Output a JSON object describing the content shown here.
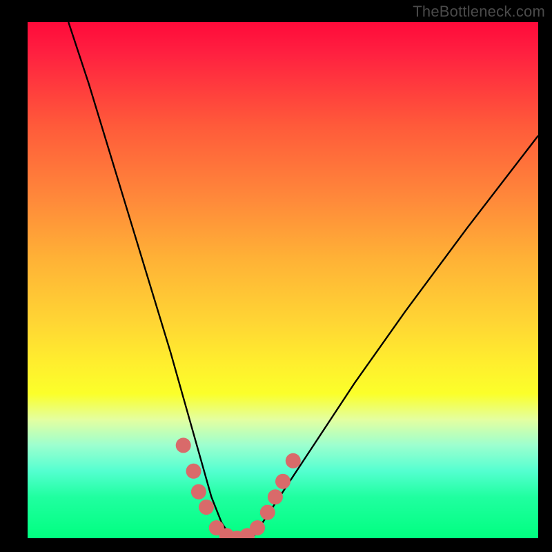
{
  "watermark": "TheBottleneck.com",
  "chart_data": {
    "type": "line",
    "title": "",
    "xlabel": "",
    "ylabel": "",
    "xlim": [
      0,
      100
    ],
    "ylim": [
      0,
      100
    ],
    "series": [
      {
        "name": "bottleneck-curve",
        "x": [
          8,
          12,
          16,
          20,
          24,
          28,
          30,
          32,
          34,
          36,
          38,
          40,
          42,
          44,
          46,
          50,
          56,
          64,
          74,
          86,
          100
        ],
        "values": [
          100,
          88,
          75,
          62,
          49,
          36,
          29,
          22,
          15,
          8,
          3,
          0,
          0,
          0,
          3,
          9,
          18,
          30,
          44,
          60,
          78
        ]
      }
    ],
    "markers": [
      {
        "name": "left-marker-1",
        "x": 30.5,
        "y": 18
      },
      {
        "name": "left-marker-2",
        "x": 32.5,
        "y": 13
      },
      {
        "name": "left-marker-3",
        "x": 33.5,
        "y": 9
      },
      {
        "name": "left-marker-4",
        "x": 35.0,
        "y": 6
      },
      {
        "name": "bottom-1",
        "x": 37.0,
        "y": 2
      },
      {
        "name": "bottom-2",
        "x": 39.0,
        "y": 0.5
      },
      {
        "name": "bottom-3",
        "x": 41.0,
        "y": 0
      },
      {
        "name": "bottom-4",
        "x": 43.0,
        "y": 0.5
      },
      {
        "name": "bottom-5",
        "x": 45.0,
        "y": 2
      },
      {
        "name": "right-marker-1",
        "x": 47.0,
        "y": 5
      },
      {
        "name": "right-marker-2",
        "x": 48.5,
        "y": 8
      },
      {
        "name": "right-marker-3",
        "x": 50.0,
        "y": 11
      },
      {
        "name": "right-marker-4",
        "x": 52.0,
        "y": 15
      }
    ],
    "gradient_stops": [
      {
        "pos": 0,
        "color": "#ff0a3a"
      },
      {
        "pos": 20,
        "color": "#ff5a3a"
      },
      {
        "pos": 46,
        "color": "#ffb236"
      },
      {
        "pos": 66,
        "color": "#ffee2e"
      },
      {
        "pos": 82,
        "color": "#9cffcf"
      },
      {
        "pos": 100,
        "color": "#00ff80"
      }
    ],
    "marker_color": "#d96a6a",
    "curve_color": "#000000"
  }
}
